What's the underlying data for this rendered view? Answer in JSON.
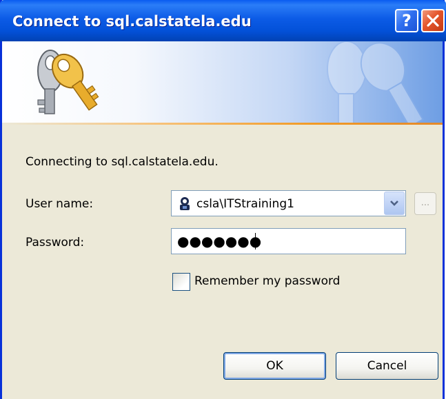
{
  "window": {
    "title": "Connect to sql.calstatela.edu",
    "help_label": "?"
  },
  "dialog": {
    "connecting_text": "Connecting to sql.calstatela.edu.",
    "username_label": "User name:",
    "username_value": "csla\\ITStraining1",
    "password_label": "Password:",
    "password_mask": "●●●●●●●",
    "browse_label": "...",
    "remember_label": "Remember my password",
    "remember_checked": false,
    "ok_label": "OK",
    "cancel_label": "Cancel"
  },
  "icons": {
    "banner": "keys-icon",
    "user": "user-account-icon",
    "dropdown": "chevron-down-icon",
    "close": "close-icon",
    "help": "help-icon"
  },
  "colors": {
    "titlebar": "#0351d8",
    "close_button": "#e4552c",
    "accent_line": "#f29b26",
    "dialog_bg": "#ece9d8"
  }
}
